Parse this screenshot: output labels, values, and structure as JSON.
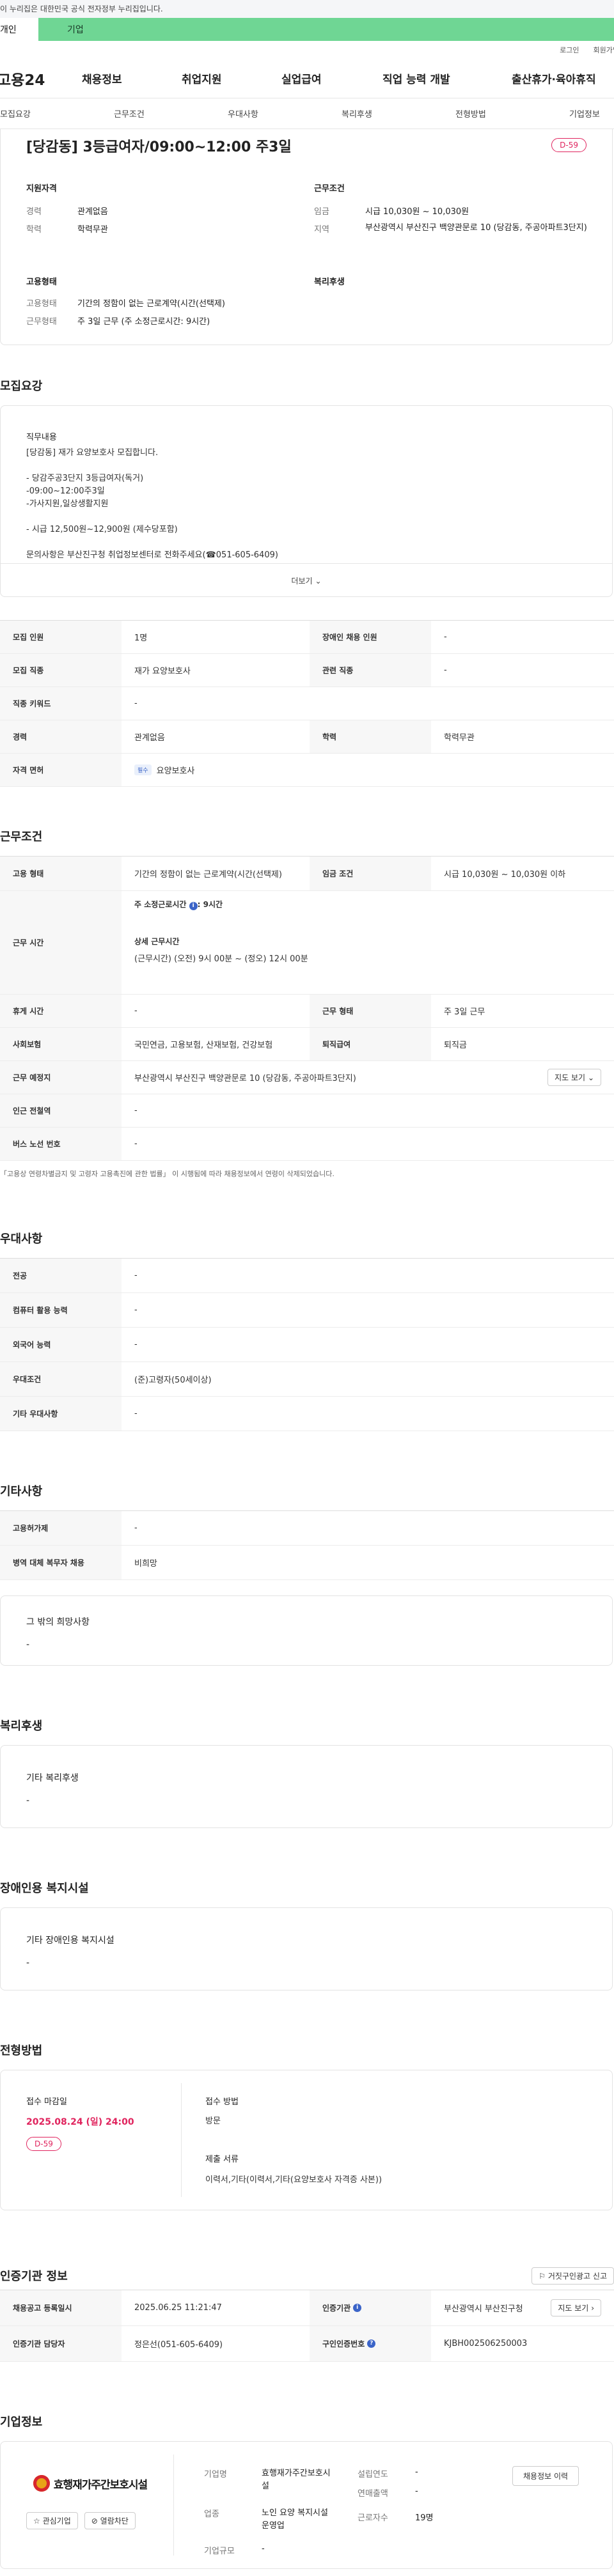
{
  "gov_banner": "이 누리집은 대한민국 공식 전자정부 누리집입니다.",
  "tabs": {
    "personal": "개인",
    "company": "기업"
  },
  "util": {
    "login": "로그인",
    "join": "회원가입"
  },
  "logo": "고용24",
  "gnb": [
    "채용정보",
    "취업지원",
    "실업급여",
    "직업 능력 개발",
    "출산휴가·육아휴직"
  ],
  "subnav": [
    "모집요강",
    "근무조건",
    "우대사항",
    "복리후생",
    "전형방법",
    "기업정보"
  ],
  "summary": {
    "title": "[당감동] 3등급여자/09:00~12:00 주3일",
    "dday": "D-59",
    "qual_title": "지원자격",
    "qual": [
      {
        "k": "경력",
        "v": "관계없음"
      },
      {
        "k": "학력",
        "v": "학력무관"
      }
    ],
    "cond_title": "근무조건",
    "cond": [
      {
        "k": "임금",
        "v": "시급 10,030원 ~ 10,030원"
      },
      {
        "k": "지역",
        "v": "부산광역시 부산진구 백양관문로 10 (당감동, 주공아파트3단지)"
      }
    ],
    "emp_title": "고용형태",
    "emp": [
      {
        "k": "고용형태",
        "v": "기간의 정함이 없는 근로계약(시간(선택제)"
      },
      {
        "k": "근무형태",
        "v": "주 3일 근무 (주 소정근로시간: 9시간)"
      }
    ],
    "welfare_title": "복리후생"
  },
  "recruit": {
    "title": "모집요강",
    "job_desc_label": "직무내용",
    "lines": [
      "[당감동] 재가 요양보호사 모집합니다.",
      "",
      "- 당감주공3단지 3등급여자(독거)",
      "-09:00~12:00주3일",
      "-가사지원,일상생활지원",
      "",
      "- 시급 12,500원~12,900원 (제수당포함)",
      "",
      "문의사항은 부산진구청 취업정보센터로 전화주세요(☎051-605-6409)"
    ],
    "more": "더보기",
    "rows": [
      [
        {
          "h": "모집 인원",
          "d": "1명"
        },
        {
          "h": "장애인 채용 인원",
          "d": "-"
        }
      ],
      [
        {
          "h": "모집 직종",
          "d": "재가 요양보호사"
        },
        {
          "h": "관련 직종",
          "d": "-"
        }
      ],
      [
        {
          "h": "직종 키워드",
          "d": "-"
        }
      ],
      [
        {
          "h": "경력",
          "d": "관계없음"
        },
        {
          "h": "학력",
          "d": "학력무관"
        }
      ]
    ],
    "license_label": "자격 면허",
    "license_badge": "필수",
    "license": "요양보호사"
  },
  "work": {
    "title": "근무조건",
    "emp_type_h": "고용 형태",
    "emp_type": "기간의 정함이 없는 근로계약(시간(선택제)",
    "wage_h": "임금 조건",
    "wage": "시급 10,030원 ~ 10,030원 이하",
    "hours_h": "근무 시간",
    "weekly": "주 소정근로시간",
    "weekly_val": ": 9시간",
    "detail_h": "상세 근무시간",
    "detail": "(근무시간) (오전) 9시 00분 ~ (정오) 12시 00분",
    "break_h": "휴게 시간",
    "break": "-",
    "form_h": "근무 형태",
    "form": "주 3일 근무",
    "ins_h": "사회보험",
    "ins": "국민연금, 고용보험, 산재보험, 건강보험",
    "ret_h": "퇴직급여",
    "ret": "퇴직금",
    "place_h": "근무 예정지",
    "place": "부산광역시 부산진구 백양관문로 10 (당감동, 주공아파트3단지)",
    "map": "지도 보기",
    "subway_h": "인근 전철역",
    "subway": "-",
    "bus_h": "버스 노선 번호",
    "bus": "-",
    "note": "「고용상 연령차별금지 및 고령자 고용촉진에 관한 법률」 이 시행됨에 따라 채용정보에서 연령이 삭제되었습니다."
  },
  "pref": {
    "title": "우대사항",
    "rows": [
      {
        "h": "전공",
        "d": "-"
      },
      {
        "h": "컴퓨터 활용 능력",
        "d": "-"
      },
      {
        "h": "외국어 능력",
        "d": "-"
      },
      {
        "h": "우대조건",
        "d": "(준)고령자(50세이상)"
      },
      {
        "h": "기타 우대사항",
        "d": "-"
      }
    ]
  },
  "etc": {
    "title": "기타사항",
    "rows": [
      {
        "h": "고용허가제",
        "d": "-"
      },
      {
        "h": "병역 대체 복무자 채용",
        "d": "비희망"
      }
    ],
    "other_title": "그 밖의 희망사항",
    "other": "-"
  },
  "welfare": {
    "title": "복리후생",
    "sub": "기타 복리후생",
    "val": "-"
  },
  "disabled": {
    "title": "장애인용 복지시설",
    "sub": "기타 장애인용 복지시설",
    "val": "-"
  },
  "screen": {
    "title": "전형방법",
    "deadline_h": "접수 마감일",
    "deadline": "2025.08.24 (일) 24:00",
    "dday": "D-59",
    "method_h": "접수 방법",
    "method": "방문",
    "docs_h": "제출 서류",
    "docs": "이력서,기타(이력서,기타(요양보호사 자격증 사본))"
  },
  "agency": {
    "title": "인증기관 정보",
    "report": "거짓구인광고 신고",
    "reg_h": "채용공고 등록일시",
    "reg": "2025.06.25 11:21:47",
    "agency_h": "인증기관",
    "agency": "부산광역시 부산진구청",
    "map": "지도 보기",
    "mgr_h": "인증기관 담당자",
    "mgr": "정은선(051-605-6409)",
    "code_h": "구인인증번호",
    "code": "KJBH002506250003"
  },
  "company": {
    "title": "기업정보",
    "logo_text": "효행재가주간보호시설",
    "fav": "관심기업",
    "block": "열람차단",
    "name_h": "기업명",
    "name": "효행재가주간보호시설",
    "year_h": "설립연도",
    "year": "-",
    "sales_h": "연매출액",
    "sales": "-",
    "biz_h": "업종",
    "biz": "노인 요양 복지시설 운영업",
    "emp_h": "근로자수",
    "emp": "19명",
    "size_h": "기업규모",
    "size": "-",
    "more": "채용정보 이력"
  }
}
